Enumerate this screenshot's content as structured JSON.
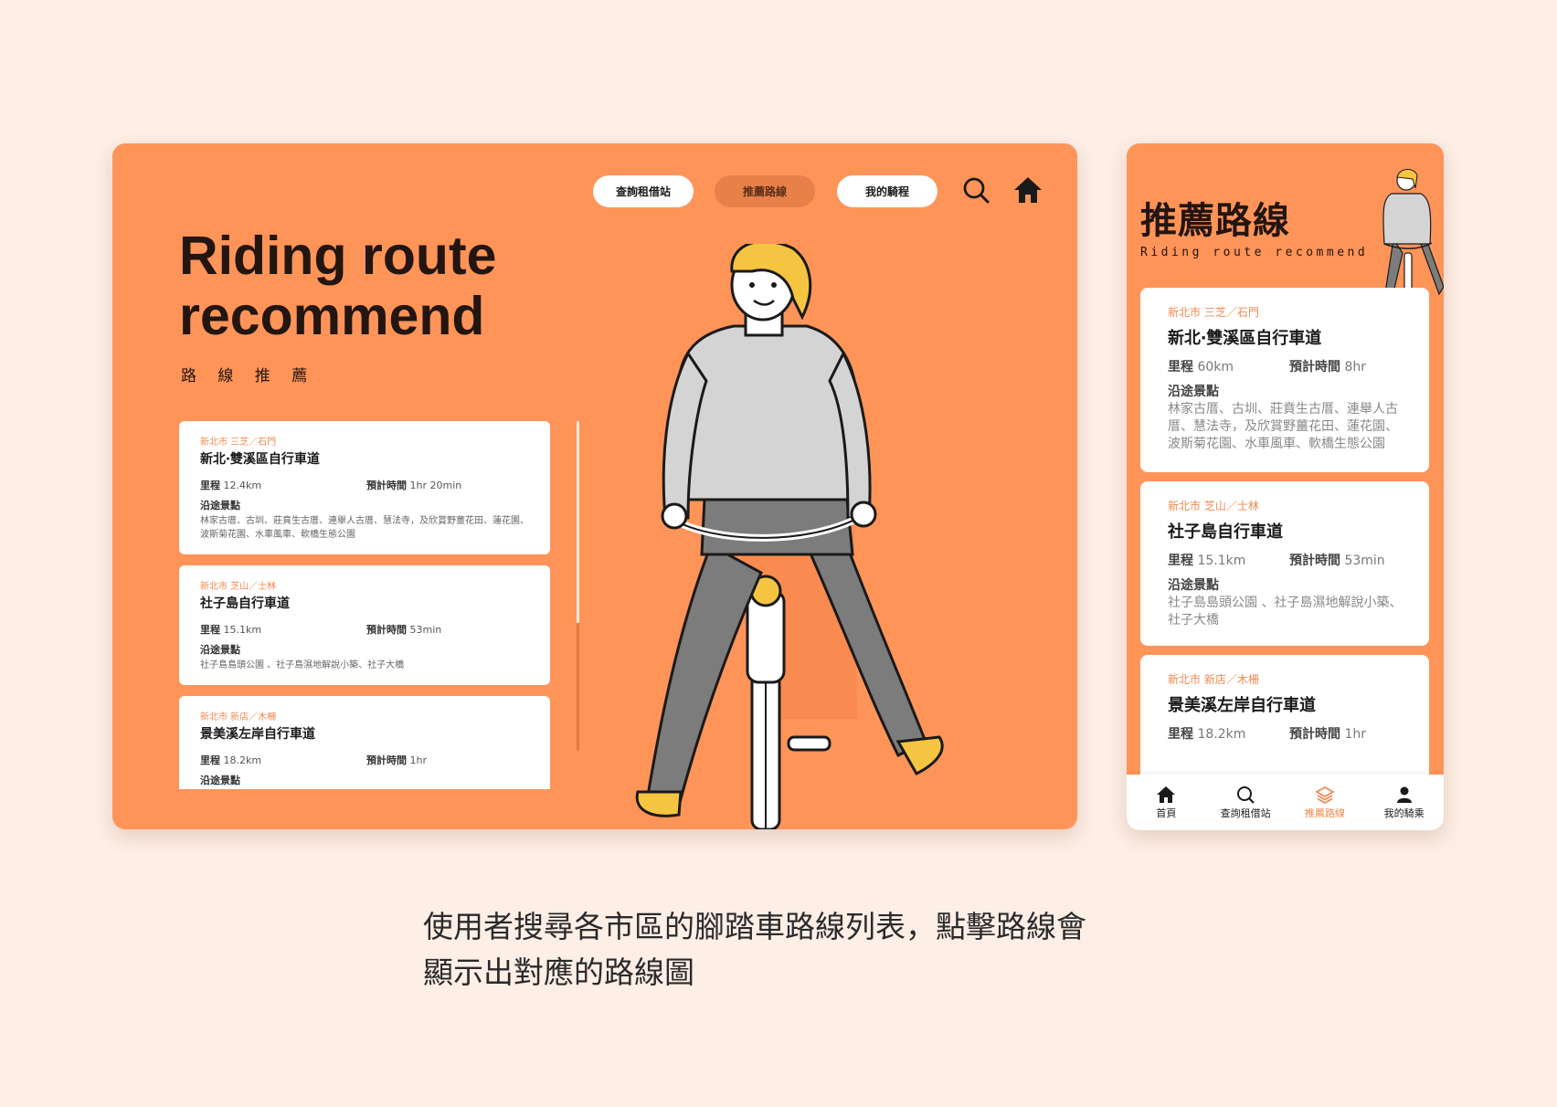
{
  "colors": {
    "background": "#fdeee6",
    "accent": "#ff9458",
    "accent_dark": "#e8804a",
    "region_text": "#f08a4f"
  },
  "desktop": {
    "nav": {
      "stations": "查詢租借站",
      "routes": "推薦路線",
      "rides": "我的騎程",
      "active": "routes"
    },
    "icons": [
      "search-icon",
      "home-icon"
    ],
    "title": "Riding route\nrecommend",
    "subtitle": "路 線 推 薦",
    "labels": {
      "distance": "里程",
      "time": "預計時間",
      "sights": "沿途景點"
    },
    "routes": [
      {
        "region": "新北市  三芝／石門",
        "name": "新北‧雙溪區自行車道",
        "distance": "12.4km",
        "time": "1hr 20min",
        "sights": "林家古厝、古圳、莊賁生古厝、連舉人古厝、慧法寺，及欣賞野薑花田、蓮花園、波斯菊花園、水車風車、軟橋生態公園"
      },
      {
        "region": "新北市  芝山／士林",
        "name": "社子島自行車道",
        "distance": "15.1km",
        "time": "53min",
        "sights": "社子島島頭公園 、社子島濕地解說小築、社子大橋"
      },
      {
        "region": "新北市  新店／木柵",
        "name": "景美溪左岸自行車道",
        "distance": "18.2km",
        "time": "1hr",
        "sights": ""
      }
    ]
  },
  "mobile": {
    "title": "推薦路線",
    "subtitle": "Riding route recommend",
    "labels": {
      "distance": "里程",
      "time": "預計時間",
      "sights": "沿途景點"
    },
    "routes": [
      {
        "region": "新北市  三芝／石門",
        "name": "新北‧雙溪區自行車道",
        "distance": "60km",
        "time": "8hr",
        "sights": "林家古厝、古圳、莊賁生古厝、連舉人古厝、慧法寺，及欣賞野薑花田、蓮花園、波斯菊花園、水車風車、軟橋生態公園"
      },
      {
        "region": "新北市  芝山／士林",
        "name": "社子島自行車道",
        "distance": "15.1km",
        "time": "53min",
        "sights": "社子島島頭公園 、社子島濕地解說小築、社子大橋"
      },
      {
        "region": "新北市  新店／木柵",
        "name": "景美溪左岸自行車道",
        "distance": "18.2km",
        "time": "1hr",
        "sights": ""
      }
    ],
    "tabs": [
      {
        "label": "首頁",
        "icon": "home-icon"
      },
      {
        "label": "查詢租借站",
        "icon": "search-icon"
      },
      {
        "label": "推薦路線",
        "icon": "layers-icon",
        "active": true
      },
      {
        "label": "我的騎乘",
        "icon": "user-icon"
      }
    ]
  },
  "caption": "使用者搜尋各市區的腳踏車路線列表，點擊路線會\n顯示出對應的路線圖"
}
